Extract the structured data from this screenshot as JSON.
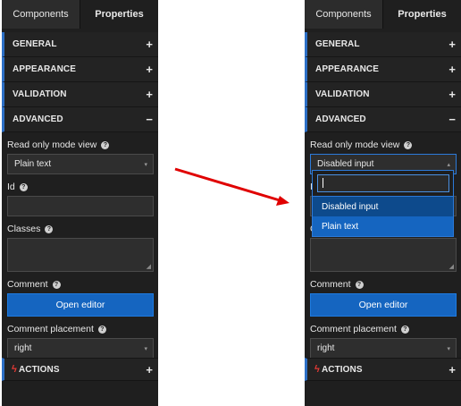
{
  "tabs": {
    "components": "Components",
    "properties": "Properties"
  },
  "sections": {
    "general": "GENERAL",
    "appearance": "APPEARANCE",
    "validation": "VALIDATION",
    "advanced": "ADVANCED",
    "actions": "ACTIONS"
  },
  "toggles": {
    "expand": "+",
    "collapse": "−"
  },
  "fields": {
    "read_only_label": "Read only mode view",
    "id_label": "Id",
    "classes_label": "Classes",
    "comment_label": "Comment",
    "comment_button": "Open editor",
    "comment_placement_label": "Comment placement",
    "comment_placement_value": "right"
  },
  "left": {
    "read_only_value": "Plain text"
  },
  "right": {
    "read_only_value": "Disabled input",
    "dropdown_options": [
      "Disabled input",
      "Plain text"
    ]
  },
  "icons": {
    "help": "?",
    "caret_down": "▾",
    "caret_up": "▴",
    "grip": "◢",
    "bolt": "ϟ"
  },
  "colors": {
    "accent": "#1565c0",
    "arrow": "#e00000",
    "panel": "#1f1f1f"
  }
}
